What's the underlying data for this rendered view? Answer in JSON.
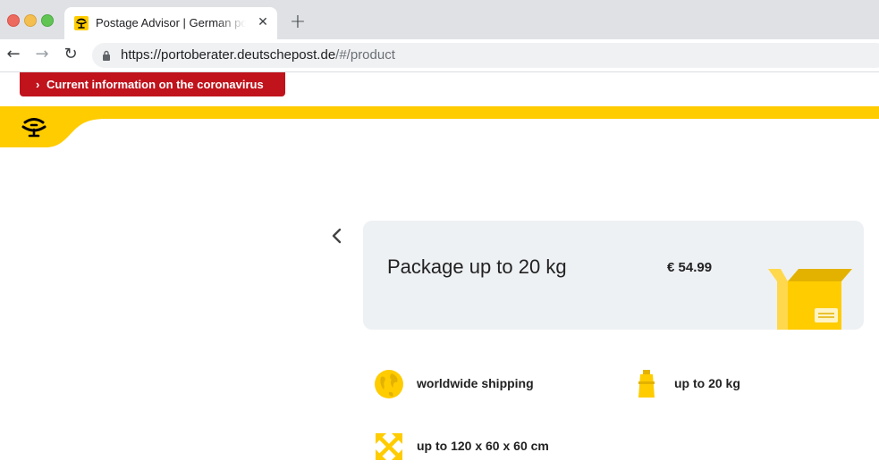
{
  "browser": {
    "tab": {
      "title": "Postage Advisor | German postage",
      "close": "✕"
    },
    "new_tab": "+",
    "nav": {
      "back": "←",
      "forward": "→",
      "reload": "↻"
    },
    "url": {
      "host": "https://portoberater.deutschepost.de",
      "path": "/#/product"
    }
  },
  "banner": {
    "label": "Current information on the coronavirus",
    "chevron": "›"
  },
  "colors": {
    "brand_yellow": "#FFCC00",
    "alert_red": "#C0131C",
    "card_bg": "#EEF1F4"
  },
  "product": {
    "title": "Package up to 20 kg",
    "price": "€ 54.99",
    "icon": "package-box-icon"
  },
  "features": [
    {
      "icon": "globe-icon",
      "label": "worldwide shipping"
    },
    {
      "icon": "weight-icon",
      "label": "up to 20 kg"
    },
    {
      "icon": "dimensions-arrows-icon",
      "label": "up to 120 x 60 x 60 cm"
    }
  ]
}
